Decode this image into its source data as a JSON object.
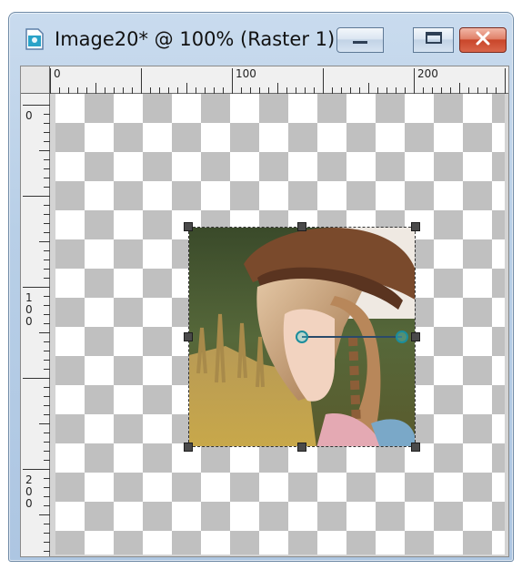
{
  "window": {
    "title": "Image20* @ 100% (Raster 1)",
    "icon": "image-document-icon",
    "controls": {
      "minimize": "minimize-icon",
      "maximize": "maximize-icon",
      "close": "close-icon"
    }
  },
  "rulers": {
    "top_labels": [
      "0",
      "100",
      "200"
    ],
    "left_labels": [
      "0",
      "1\n0\n0",
      "2\n0\n0"
    ]
  },
  "colors": {
    "close_button": "#d3563a",
    "checker_gray": "#c0c0c0",
    "rotation_handle": "#1b8d9c"
  }
}
